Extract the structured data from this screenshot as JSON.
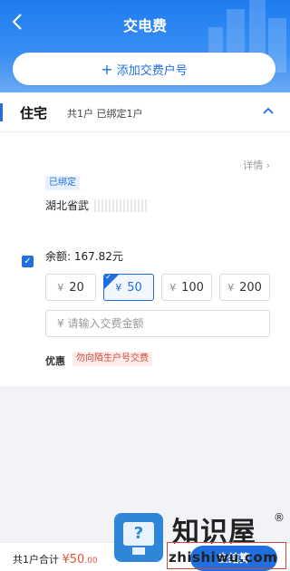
{
  "header": {
    "title": "交电费",
    "back_icon": "chevron-left-icon",
    "add_account_label": "添加交费户号",
    "add_icon": "plus-icon"
  },
  "section": {
    "name": "住宅",
    "badge_count": "1",
    "summary": "共1户 已绑定1户",
    "collapse_icon": "chevron-up-icon"
  },
  "account": {
    "detail_label": "详情",
    "bound_tag": "已绑定",
    "address": "湖北省武",
    "checked": true,
    "balance_label": "余额:",
    "balance_value": "167.82元"
  },
  "amount_options": {
    "currency": "¥",
    "items": [
      {
        "value": "20",
        "selected": false
      },
      {
        "value": "50",
        "selected": true
      },
      {
        "value": "100",
        "selected": false
      },
      {
        "value": "200",
        "selected": false
      }
    ]
  },
  "amount_input": {
    "placeholder": "¥  请输入交费金额"
  },
  "promo": {
    "label": "优惠",
    "tag": "勿向陌生户号交费"
  },
  "footer": {
    "total_label": "共1户合计",
    "total_currency": "¥",
    "total_value": "50",
    "total_decimal": ".00",
    "pay_button": "去结算"
  },
  "watermark": {
    "cn": "知识屋",
    "reg": "®",
    "url": "zhishiwu.com"
  },
  "colors": {
    "primary": "#1f6fe0",
    "accent_red": "#e0543e",
    "badge_red": "#ef6b5b"
  }
}
